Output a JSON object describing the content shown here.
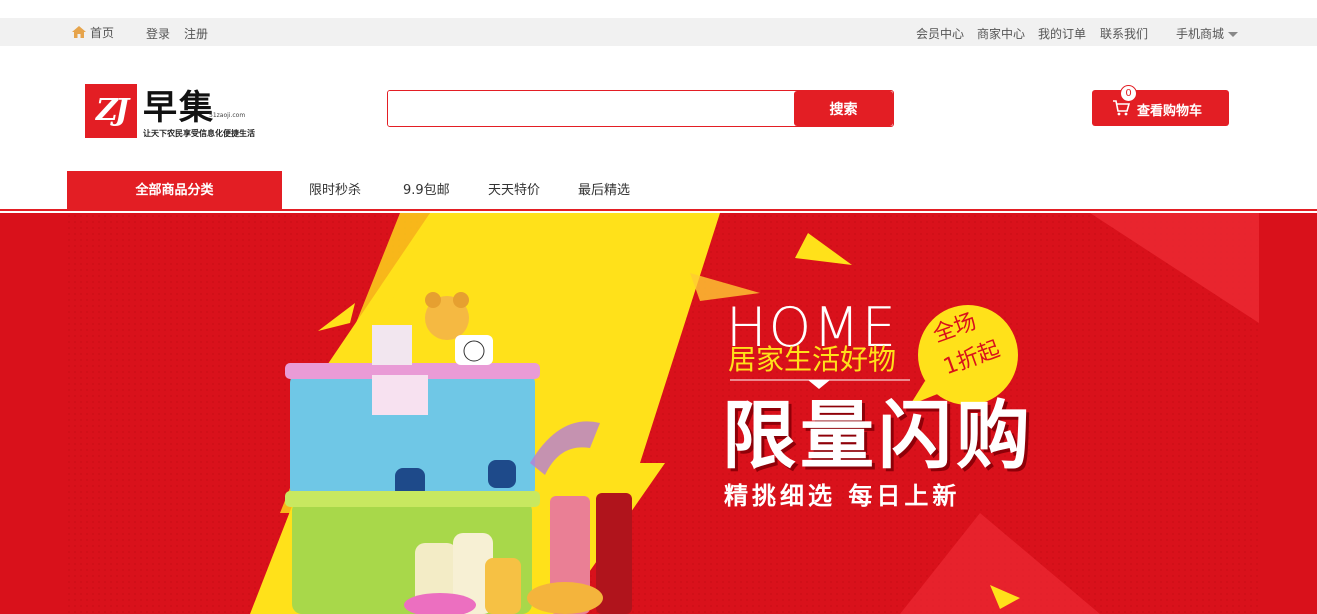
{
  "topbar": {
    "home": "首页",
    "login": "登录",
    "register": "注册",
    "links": [
      "会员中心",
      "商家中心",
      "我的订单",
      "联系我们"
    ],
    "mobile": "手机商城"
  },
  "header": {
    "logo_mark": "ZJ",
    "logo_name": "早集",
    "logo_domain": "51zaoji.com",
    "slogan": "让天下农民享受信息化便捷生活",
    "search_value": "",
    "search_button": "搜索",
    "cart_label": "查看购物车",
    "cart_count": "0"
  },
  "nav": {
    "all_categories": "全部商品分类",
    "items": [
      "限时秒杀",
      "9.9包邮",
      "天天特价",
      "最后精选"
    ]
  },
  "banner": {
    "home": "HOME",
    "subtitle": "居家生活好物",
    "badge_line1": "全场",
    "badge_line2": "1折起",
    "headline": "限量闪购",
    "tagline": "精挑细选 每日上新"
  },
  "colors": {
    "brand": "#e31e24",
    "banner_red": "#d9111b",
    "banner_yellow": "#ffe11a"
  }
}
